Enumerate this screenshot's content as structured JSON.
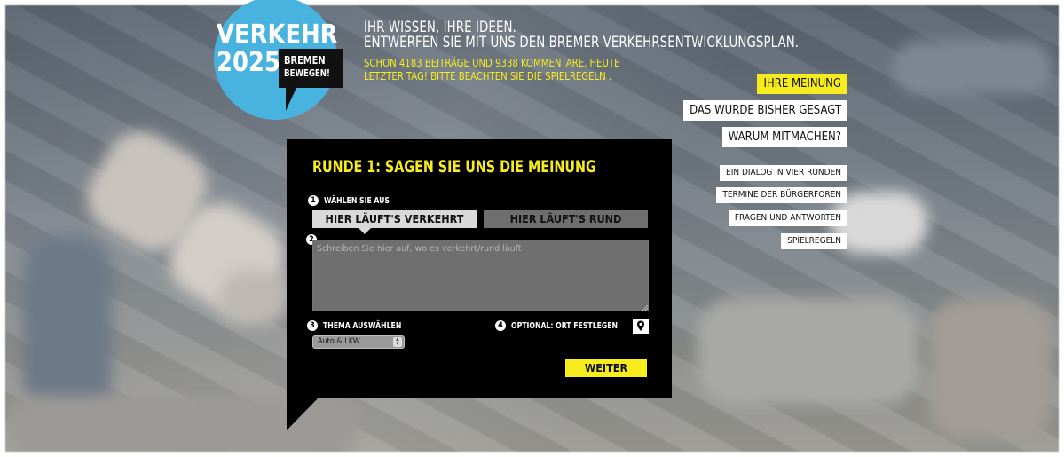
{
  "logo": {
    "line1": "VERKEHR",
    "line2": "2025",
    "tag1": "BREMEN",
    "tag2": "BEWEGEN!"
  },
  "header": {
    "line1": "IHR WISSEN, IHRE IDEEN.",
    "line2": "ENTWERFEN SIE MIT UNS DEN BREMER VERKEHRSENTWICKLUNGSPLAN.",
    "status1": "SCHON 4183 BEITRÄGE UND 9338 KOMMENTARE. HEUTE",
    "status2": "LETZTER TAG! BITTE BEACHTEN SIE DIE SPIELREGELN ."
  },
  "nav": {
    "main": [
      "IHRE MEINUNG",
      "DAS WURDE BISHER GESAGT",
      "WARUM MITMACHEN?"
    ],
    "sub": [
      "EIN DIALOG IN VIER RUNDEN",
      "TERMINE DER BÜRGERFOREN",
      "FRAGEN UND ANTWORTEN",
      "SPIELREGELN"
    ]
  },
  "form": {
    "title": "RUNDE 1: SAGEN SIE UNS DIE MEINUNG",
    "step1_num": "1",
    "step1_label": "WÄHLEN SIE AUS",
    "choice_a": "HIER LÄUFT'S VERKEHRT",
    "choice_b": "HIER LÄUFT'S RUND",
    "step2_num": "2",
    "textarea_placeholder": "Schreiben Sie hier auf, wo es verkehrt/rund läuft",
    "step3_num": "3",
    "step3_label": "THEMA AUSWÄHLEN",
    "topic_value": "Auto & LKW",
    "step4_num": "4",
    "step4_label": "OPTIONAL: ORT FESTLEGEN",
    "submit": "WEITER"
  },
  "colors": {
    "accent": "#f7ec1e",
    "logo_blue": "#49b3df",
    "panel": "#000000"
  }
}
